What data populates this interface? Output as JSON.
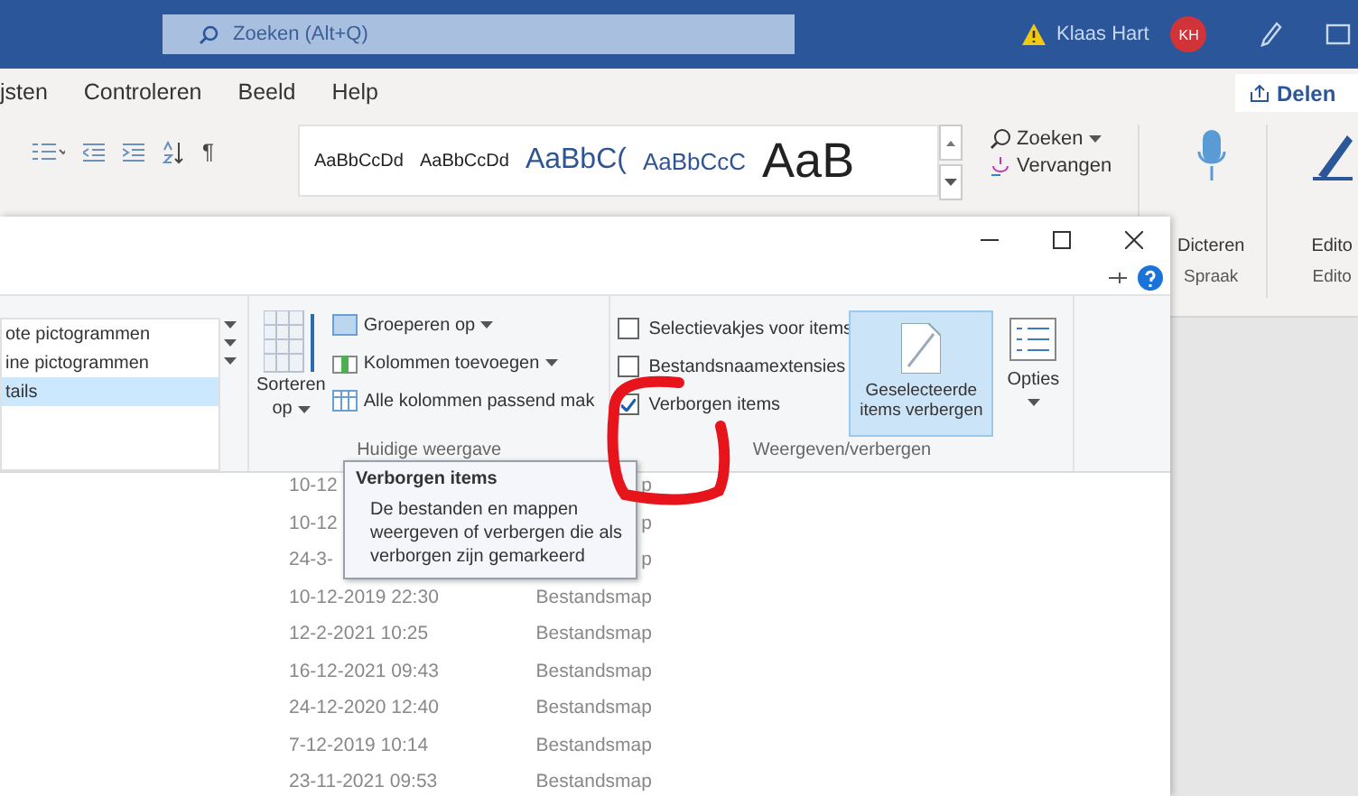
{
  "word": {
    "search_placeholder": "Zoeken (Alt+Q)",
    "user": "Klaas Hart",
    "user_initials": "KH",
    "tabs": [
      {
        "label": "jsten",
        "selected": false
      },
      {
        "label": "Controleren",
        "selected": false
      },
      {
        "label": "Beeld",
        "selected": false
      },
      {
        "label": "Help",
        "selected": false
      }
    ],
    "share_button": "Delen",
    "pilcrow": "¶",
    "styles": [
      {
        "sample": "AaBbCcDd",
        "kind": "normal"
      },
      {
        "sample": "AaBbCcDd",
        "kind": "normal"
      },
      {
        "sample": "AaBbC(",
        "kind": "heading1"
      },
      {
        "sample": "AaBbCcC",
        "kind": "heading2"
      },
      {
        "sample": "AaB",
        "kind": "title"
      }
    ],
    "find_button": "Zoeken",
    "replace_button": "Vervangen",
    "dictate_button": "Dicteren",
    "speech_group": "Spraak",
    "editor_button": "Edito",
    "editor_group": "Edito"
  },
  "explorer": {
    "layouts": [
      {
        "label": "ote pictogrammen",
        "selected": false
      },
      {
        "label": "ine pictogrammen",
        "selected": false
      },
      {
        "label": "tails",
        "selected": true
      }
    ],
    "sort_button": [
      "Sorteren",
      "op"
    ],
    "view_commands": [
      {
        "label": "Groeperen op",
        "dropdown": true,
        "kind": "group"
      },
      {
        "label": "Kolommen toevoegen",
        "dropdown": true,
        "kind": "columns"
      },
      {
        "label": "Alle kolommen passend mak",
        "dropdown": false,
        "kind": "fit"
      }
    ],
    "current_view_group": "Huidige weergave",
    "toggles": [
      {
        "label": "Selectievakjes voor items",
        "checked": false
      },
      {
        "label": "Bestandsnaamextensies",
        "checked": false
      },
      {
        "label": "Verborgen items",
        "checked": true
      }
    ],
    "hide_selected_button": {
      "lines": [
        "Geselecteerde",
        "items verbergen"
      ],
      "selected": true
    },
    "options_button": "Opties",
    "show_hide_group": "Weergeven/verbergen",
    "tooltip": {
      "title": "Verborgen items",
      "lines": [
        "De bestanden en mappen",
        "weergeven of verbergen die als",
        "verborgen zijn gemarkeerd"
      ]
    },
    "files": [
      {
        "date": "10-12",
        "type": "p"
      },
      {
        "date": "10-12",
        "type": "p"
      },
      {
        "date": "24-3-",
        "type": "p"
      },
      {
        "date": "10-12-2019 22:30",
        "type": "Bestandsmap"
      },
      {
        "date": "12-2-2021 10:25",
        "type": "Bestandsmap"
      },
      {
        "date": "16-12-2021 09:43",
        "type": "Bestandsmap"
      },
      {
        "date": "24-12-2020 12:40",
        "type": "Bestandsmap"
      },
      {
        "date": "7-12-2019 10:14",
        "type": "Bestandsmap"
      },
      {
        "date": "23-11-2021 09:53",
        "type": "Bestandsmap"
      }
    ]
  }
}
